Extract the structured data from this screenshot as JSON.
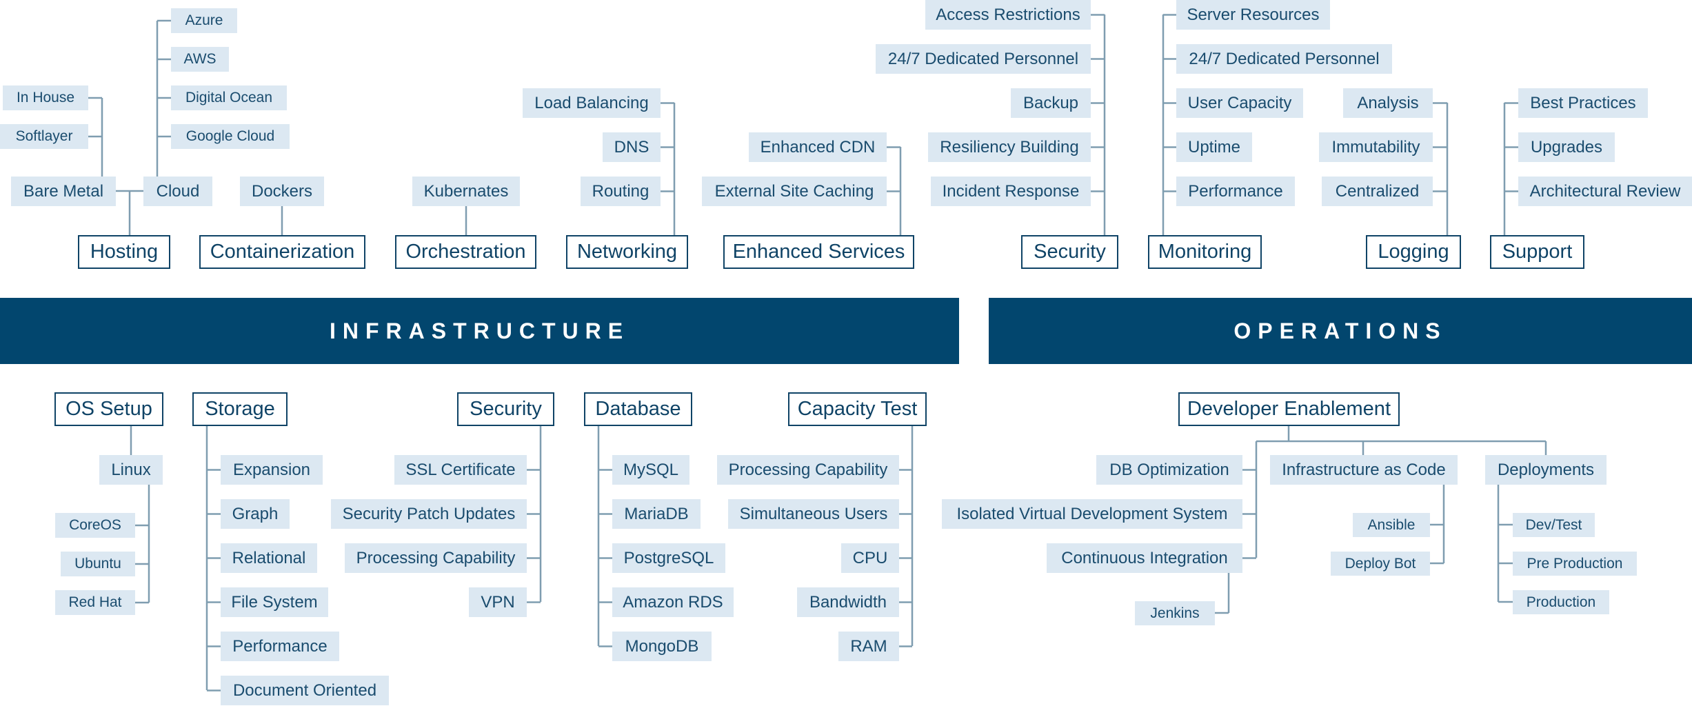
{
  "banners": {
    "infrastructure": "INFRASTRUCTURE",
    "operations": "OPERATIONS"
  },
  "colors": {
    "banner": "#02466e",
    "leaf_fill": "#dce8f2",
    "category_border": "#0f4366",
    "connector": "#7f9db0",
    "text": "#1a4c6e"
  },
  "infrastructure_top": {
    "hosting": {
      "label": "Hosting",
      "children": [
        "Bare Metal",
        "Cloud"
      ],
      "bare_metal_children": [
        "In House",
        "Softlayer"
      ],
      "cloud_children": [
        "Azure",
        "AWS",
        "Digital Ocean",
        "Google Cloud"
      ]
    },
    "containerization": {
      "label": "Containerization",
      "children": [
        "Dockers"
      ]
    },
    "orchestration": {
      "label": "Orchestration",
      "children": [
        "Kubernates"
      ]
    },
    "networking": {
      "label": "Networking",
      "children": [
        "Load Balancing",
        "DNS",
        "Routing"
      ]
    },
    "enhanced_services": {
      "label": "Enhanced Services",
      "children": [
        "Enhanced CDN",
        "External Site Caching"
      ]
    }
  },
  "operations_top": {
    "security": {
      "label": "Security",
      "children": [
        "Access Restrictions",
        "24/7 Dedicated Personnel",
        "Backup",
        "Resiliency Building",
        "Incident Response"
      ]
    },
    "monitoring": {
      "label": "Monitoring",
      "children": [
        "Server Resources",
        "24/7 Dedicated Personnel",
        "User Capacity",
        "Uptime",
        "Performance"
      ]
    },
    "logging": {
      "label": "Logging",
      "children": [
        "Analysis",
        "Immutability",
        "Centralized"
      ]
    },
    "support": {
      "label": "Support",
      "children": [
        "Best Practices",
        "Upgrades",
        "Architectural Review"
      ]
    }
  },
  "infrastructure_bottom": {
    "os_setup": {
      "label": "OS Setup",
      "children": [
        "Linux"
      ],
      "linux_children": [
        "CoreOS",
        "Ubuntu",
        "Red Hat"
      ]
    },
    "storage": {
      "label": "Storage",
      "children": [
        "Expansion",
        "Graph",
        "Relational",
        "File System",
        "Performance",
        "Document Oriented"
      ]
    },
    "security": {
      "label": "Security",
      "children": [
        "SSL Certificate",
        "Security Patch Updates",
        "Processing Capability",
        "VPN"
      ]
    },
    "database": {
      "label": "Database",
      "children": [
        "MySQL",
        "MariaDB",
        "PostgreSQL",
        "Amazon RDS",
        "MongoDB"
      ]
    },
    "capacity_test": {
      "label": "Capacity Test",
      "children": [
        "Processing Capability",
        "Simultaneous Users",
        "CPU",
        "Bandwidth",
        "RAM"
      ]
    }
  },
  "operations_bottom": {
    "developer_enablement": {
      "label": "Developer Enablement",
      "left_children": [
        "DB Optimization",
        "Isolated Virtual Development System",
        "Continuous Integration"
      ],
      "ci_children": [
        "Jenkins"
      ],
      "infrastructure_as_code": {
        "label": "Infrastructure as Code",
        "children": [
          "Ansible",
          "Deploy Bot"
        ]
      },
      "deployments": {
        "label": "Deployments",
        "children": [
          "Dev/Test",
          "Pre Production",
          "Production"
        ]
      }
    }
  }
}
